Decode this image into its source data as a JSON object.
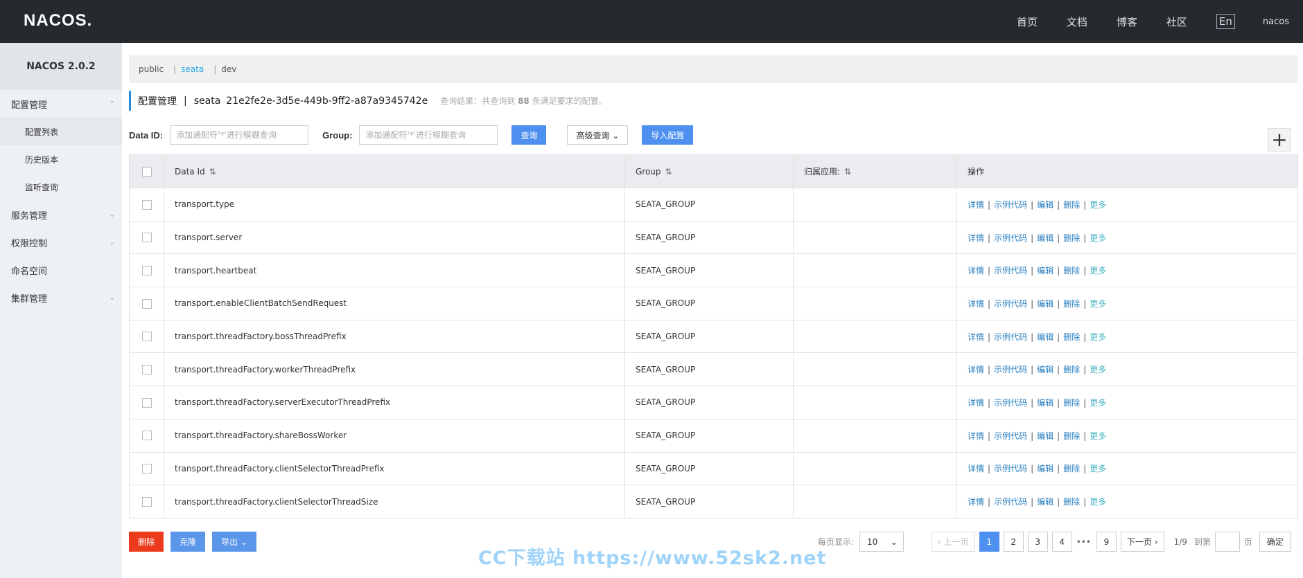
{
  "header": {
    "logo": "NACOS.",
    "nav": [
      "首页",
      "文档",
      "博客",
      "社区"
    ],
    "lang": "En",
    "user": "nacos"
  },
  "sidebar": {
    "version": "NACOS 2.0.2",
    "groups": [
      {
        "label": "配置管理",
        "expanded": true,
        "items": [
          {
            "label": "配置列表",
            "active": true
          },
          {
            "label": "历史版本",
            "active": false
          },
          {
            "label": "监听查询",
            "active": false
          }
        ]
      },
      {
        "label": "服务管理",
        "expanded": false
      },
      {
        "label": "权限控制",
        "expanded": false
      },
      {
        "label": "命名空间"
      },
      {
        "label": "集群管理",
        "expanded": false
      }
    ]
  },
  "namespaces": {
    "items": [
      "public",
      "seata",
      "dev"
    ],
    "active": "seata"
  },
  "title": {
    "section": "配置管理",
    "divider": "|",
    "ns_name": "seata",
    "ns_id": "21e2fe2e-3d5e-449b-9ff2-a87a9345742e",
    "result_prefix": "查询结果：共查询到",
    "result_count": "88",
    "result_suffix": "条满足要求的配置。"
  },
  "search": {
    "dataid_label": "Data ID:",
    "dataid_placeholder": "添加通配符'*'进行模糊查询",
    "group_label": "Group:",
    "group_placeholder": "添加通配符'*'进行模糊查询",
    "query_button": "查询",
    "advanced_button": "高级查询",
    "import_button": "导入配置",
    "add_button": "+"
  },
  "table": {
    "columns": [
      "Data Id",
      "Group",
      "归属应用:",
      "操作"
    ],
    "actions": [
      "详情",
      "示例代码",
      "编辑",
      "删除",
      "更多"
    ],
    "rows": [
      {
        "data_id": "transport.type",
        "group": "SEATA_GROUP",
        "app": ""
      },
      {
        "data_id": "transport.server",
        "group": "SEATA_GROUP",
        "app": ""
      },
      {
        "data_id": "transport.heartbeat",
        "group": "SEATA_GROUP",
        "app": ""
      },
      {
        "data_id": "transport.enableClientBatchSendRequest",
        "group": "SEATA_GROUP",
        "app": ""
      },
      {
        "data_id": "transport.threadFactory.bossThreadPrefix",
        "group": "SEATA_GROUP",
        "app": ""
      },
      {
        "data_id": "transport.threadFactory.workerThreadPrefix",
        "group": "SEATA_GROUP",
        "app": ""
      },
      {
        "data_id": "transport.threadFactory.serverExecutorThreadPrefix",
        "group": "SEATA_GROUP",
        "app": ""
      },
      {
        "data_id": "transport.threadFactory.shareBossWorker",
        "group": "SEATA_GROUP",
        "app": ""
      },
      {
        "data_id": "transport.threadFactory.clientSelectorThreadPrefix",
        "group": "SEATA_GROUP",
        "app": ""
      },
      {
        "data_id": "transport.threadFactory.clientSelectorThreadSize",
        "group": "SEATA_GROUP",
        "app": ""
      }
    ]
  },
  "footer": {
    "delete_button": "删除",
    "clone_button": "克隆",
    "export_button": "导出"
  },
  "pagination": {
    "page_size_label": "每页显示:",
    "page_size": "10",
    "prev": "上一页",
    "pages": [
      "1",
      "2",
      "3",
      "4"
    ],
    "ellipsis": "•••",
    "last_page": "9",
    "next": "下一页",
    "current": "1",
    "total": "1/9",
    "goto_label": "到第",
    "page_unit": "页",
    "confirm": "确定"
  },
  "watermark": "CC下载站 https://www.52sk2.net"
}
